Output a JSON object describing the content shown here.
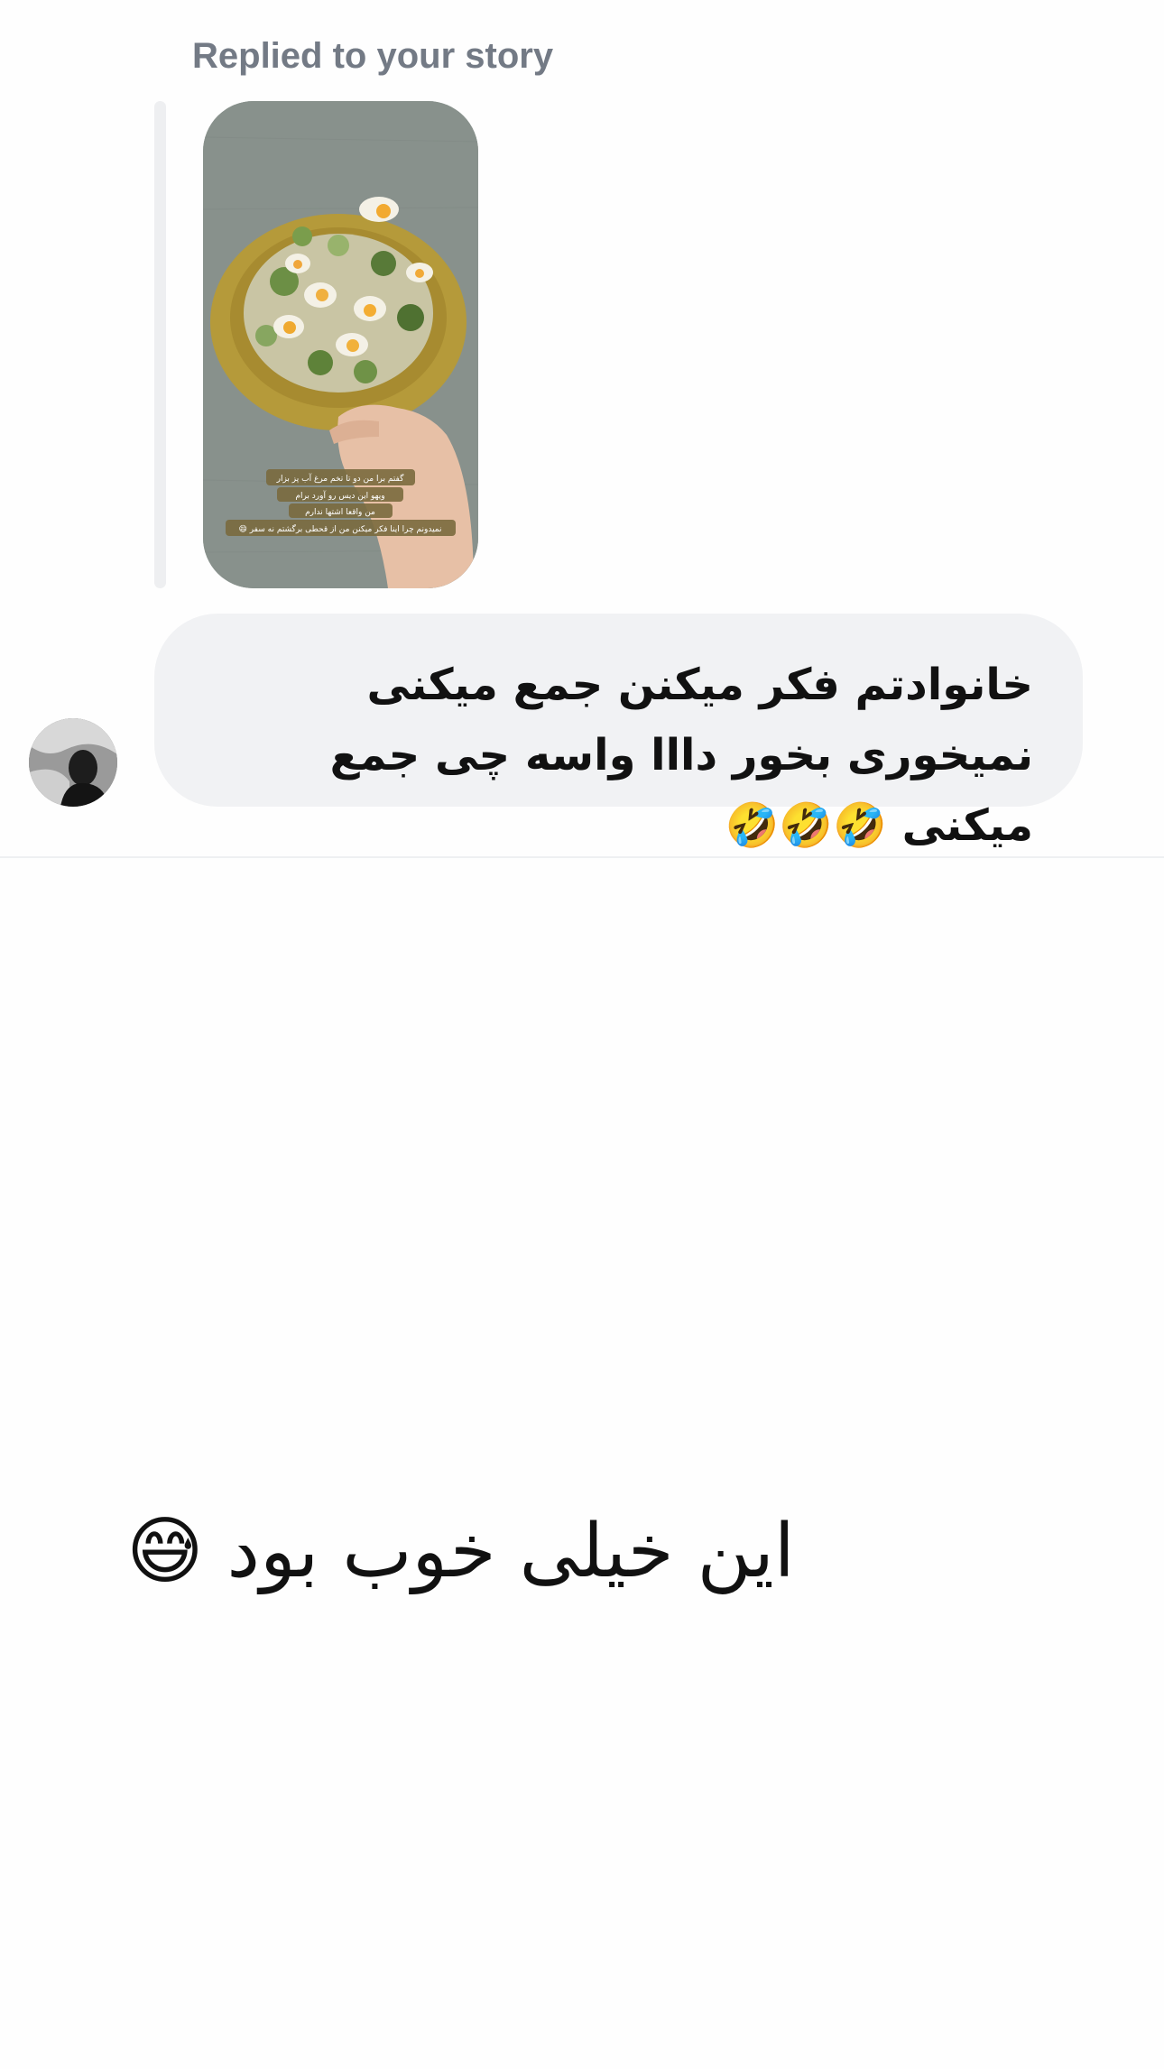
{
  "story_reply": {
    "label": "Replied to your story",
    "story_overlay_lines": [
      "گفتم برا من دو تا تخم مرغ آب پز بزار",
      "ویهو این دیس رو آورد برام",
      "من واقعا اشتها ندارم",
      "نمیدونم چرا اینا فکر میکنن من از قحطی برگشتم نه سفر 😄"
    ]
  },
  "incoming_message": {
    "text": "خانوادتم فکر میکنن جمع میکنی نمیخوری بخور دااا واسه چی جمع میکنی 🤣🤣🤣"
  },
  "outgoing_message": {
    "text": "این خیلی خوب بود 😅"
  },
  "colors": {
    "label_gray": "#737a85",
    "bubble_bg": "#f1f2f4",
    "reply_bar": "#eeeff1",
    "text": "#111111"
  }
}
